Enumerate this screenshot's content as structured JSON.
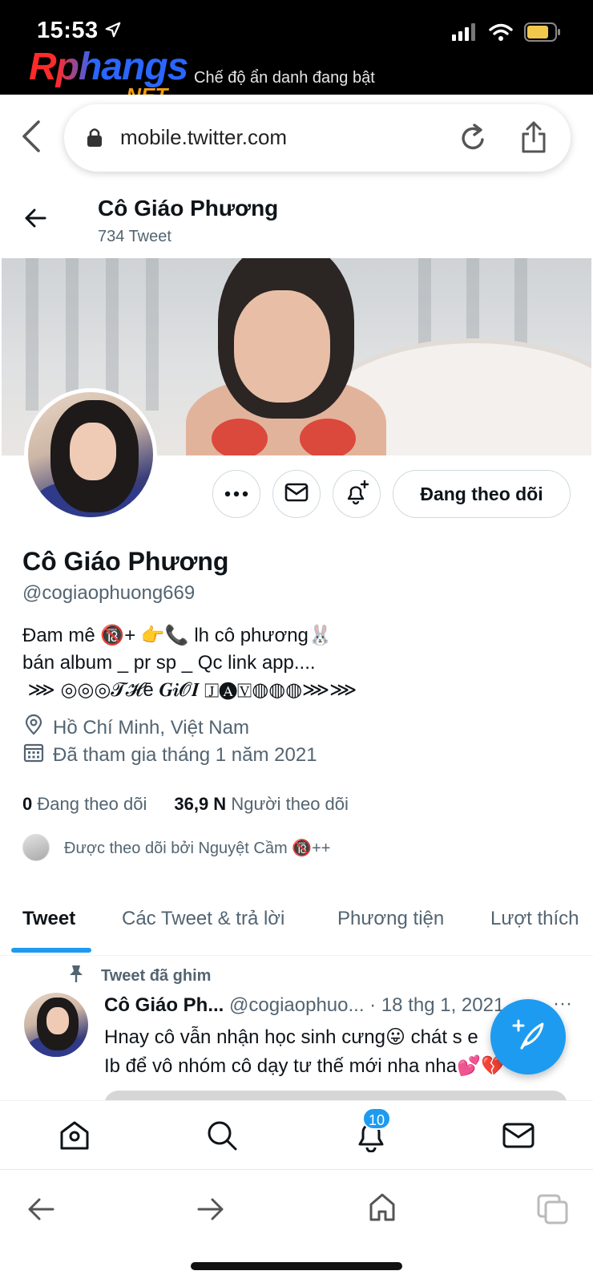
{
  "status": {
    "time": "15:53",
    "watermark": "Rphangs",
    "watermark_suffix": ".NET",
    "incognito_text": "Chế độ ẩn danh đang bật"
  },
  "browser": {
    "url": "mobile.twitter.com"
  },
  "header": {
    "title": "Cô Giáo Phương",
    "tweet_count": "734 Tweet"
  },
  "profile": {
    "follow_button": "Đang theo dõi",
    "name": "Cô Giáo Phương",
    "handle": "@cogiaophuong669",
    "bio": "Đam mê 🔞+ 👉📞 lh cô phương🐰\nbán album _ pr sp _ Qc link app....\n ⋙ ◎◎◎𝓣𝓗ē 𝑮𝒊𝓞𝑰 🄹🅐🅅◍◍◍⋙⋙",
    "location": "Hồ Chí Minh, Việt Nam",
    "joined": "Đã tham gia tháng 1 năm 2021",
    "following_count": "0",
    "following_label": "Đang theo dõi",
    "followers_count": "36,9 N",
    "followers_label": "Người theo dõi",
    "followed_by": "Được theo dõi bởi Nguyệt Cầm 🔞++"
  },
  "tabs": [
    "Tweet",
    "Các Tweet & trả lời",
    "Phương tiện",
    "Lượt thích"
  ],
  "tweet": {
    "pinned_label": "Tweet đã ghim",
    "name": "Cô Giáo Ph...",
    "handle": "@cogiaophuo...",
    "date": "· 18 thg 1, 2021",
    "more": "···",
    "text": "Hnay cô vẫn nhận học sinh cưng😛 chát s e\nIb để vô nhóm cô dạy tư thế mới nha nha💕💔"
  },
  "nav": {
    "notification_badge": "10"
  }
}
